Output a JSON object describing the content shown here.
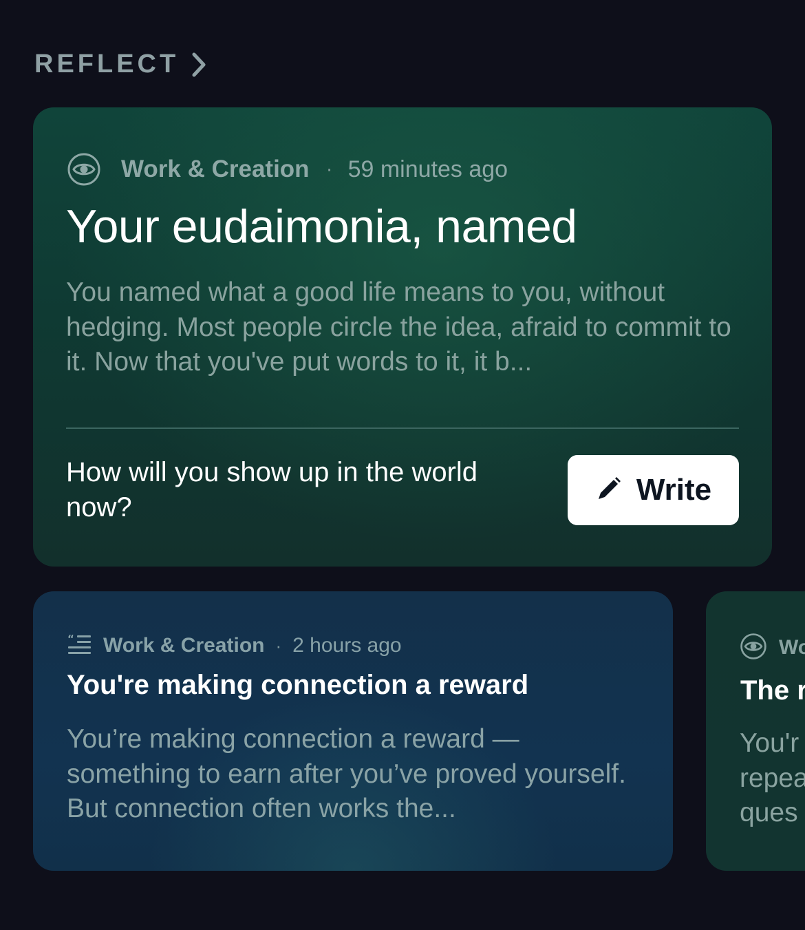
{
  "section": {
    "title": "REFLECT",
    "chevron_icon": "chevron-right-icon"
  },
  "featured": {
    "icon": "eye-icon",
    "category": "Work & Creation",
    "separator": "·",
    "time": "59 minutes ago",
    "title": "Your eudaimonia, named",
    "body": "You named what a good life means to you, without hedging. Most people circle the idea, afraid to commit to it. Now that you've put words to it, it b...",
    "prompt": "How will you show up in the world now?",
    "write_button": {
      "icon": "pencil-icon",
      "label": "Write"
    },
    "colors": {
      "background": "#10443a",
      "button": "#ffffff"
    }
  },
  "cards": [
    {
      "icon": "quote-list-icon",
      "category": "Work & Creation",
      "separator": "·",
      "time": "2 hours ago",
      "title": "You're making connection a reward",
      "body": "You’re making connection a reward — something to earn after you’ve proved yourself. But connection often works the...",
      "color": "#13304a"
    },
    {
      "icon": "eye-icon",
      "category": "Wo",
      "title": "The r",
      "body": "You'r\nrepea\nques",
      "color": "#12342f"
    }
  ],
  "colors": {
    "page_background": "#0e0f1a",
    "muted_text": "#8ea8a6"
  }
}
